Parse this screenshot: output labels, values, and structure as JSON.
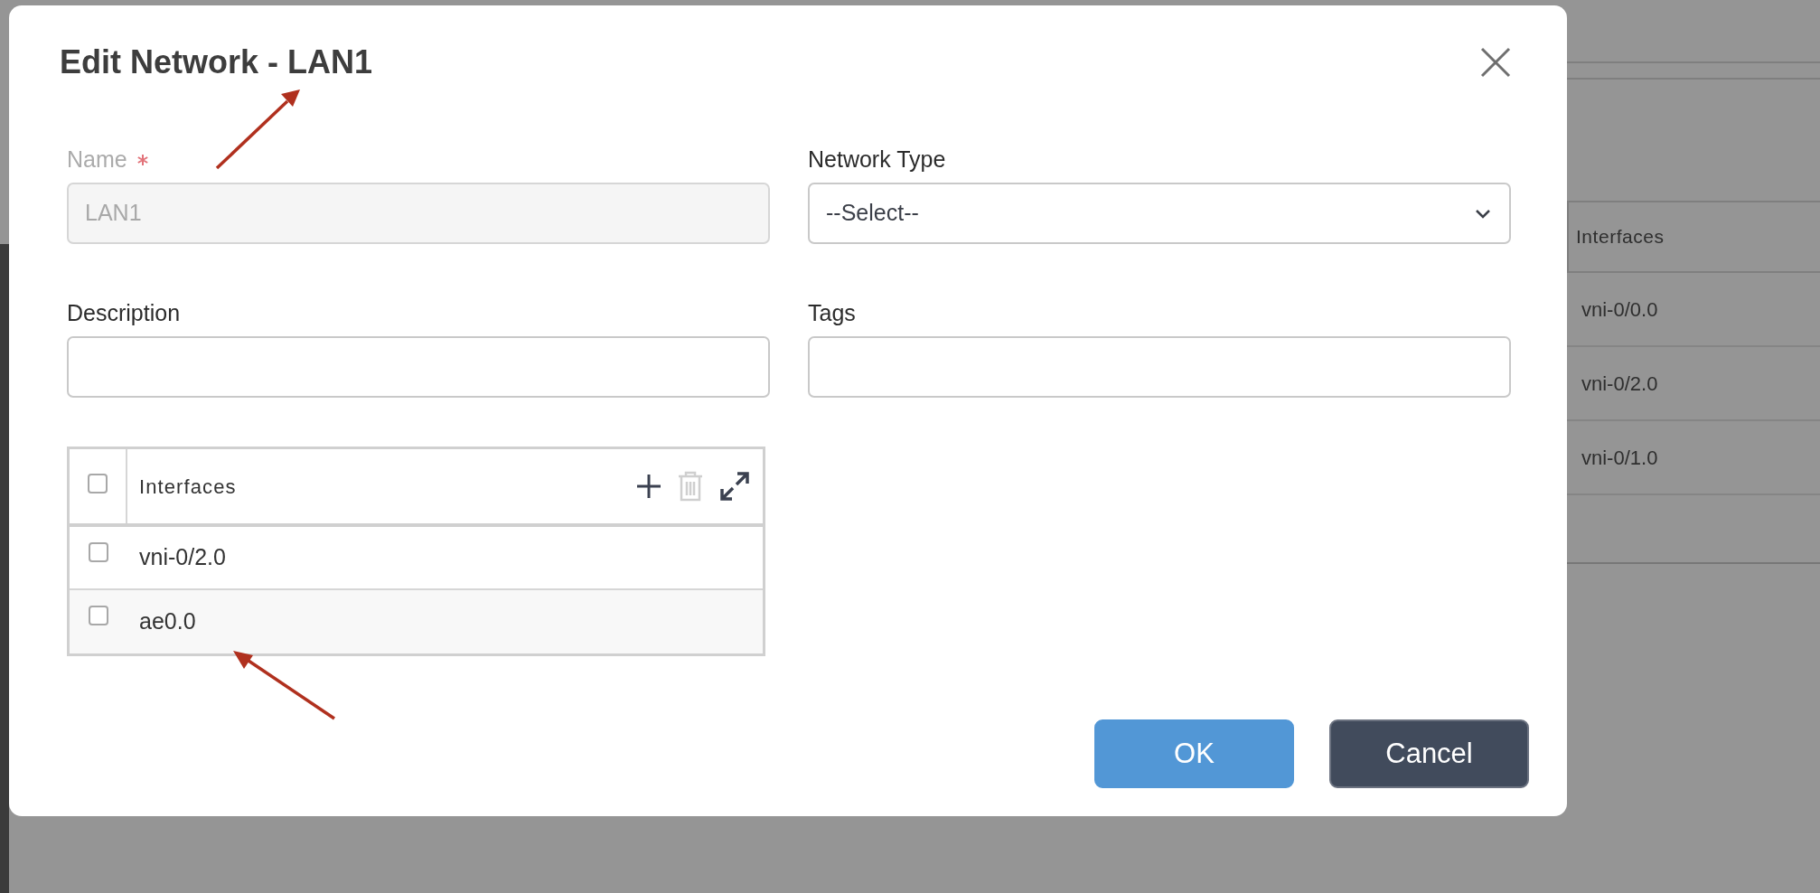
{
  "background": {
    "table": {
      "columns": [
        "Interfaces"
      ],
      "rows": [
        "vni-0/0.0",
        "vni-0/2.0",
        "vni-0/1.0"
      ]
    }
  },
  "dialog": {
    "title": "Edit Network - LAN1",
    "fields": [
      {
        "kind": "text",
        "label": "Name",
        "required": true,
        "disabled": true,
        "value": "LAN1"
      },
      {
        "kind": "select",
        "label": "Network Type",
        "required": false,
        "disabled": false,
        "value": "--Select--"
      },
      {
        "kind": "text",
        "label": "Description",
        "required": false,
        "disabled": false
      },
      {
        "kind": "text",
        "label": "Tags",
        "required": false,
        "disabled": false
      }
    ],
    "interfaces": {
      "header": "Interfaces",
      "header_checked": false,
      "rows": [
        {
          "name": "vni-0/2.0",
          "checked": false
        },
        {
          "name": "ae0.0",
          "checked": false
        }
      ]
    },
    "buttons": [
      {
        "label": "OK",
        "kind": "primary"
      },
      {
        "label": "Cancel",
        "kind": "secondary"
      }
    ]
  }
}
